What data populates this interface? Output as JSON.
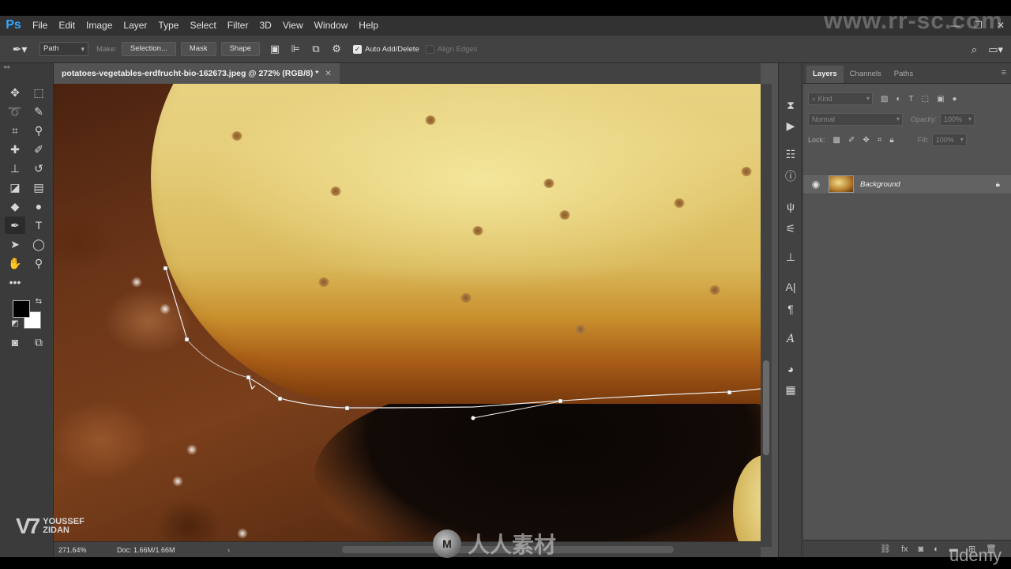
{
  "app": {
    "logo": "Ps"
  },
  "menu": [
    "File",
    "Edit",
    "Image",
    "Layer",
    "Type",
    "Select",
    "Filter",
    "3D",
    "View",
    "Window",
    "Help"
  ],
  "options": {
    "tool_mode": "Path",
    "make_label": "Make:",
    "selection_btn": "Selection...",
    "mask_btn": "Mask",
    "shape_btn": "Shape",
    "auto_add_delete": "Auto Add/Delete",
    "align_edges": "Align Edges"
  },
  "document": {
    "tab_title": "potatoes-vegetables-erdfrucht-bio-162673.jpeg @ 272% (RGB/8) *",
    "zoom": "271.64%",
    "doc_size": "Doc: 1.66M/1.66M"
  },
  "layers_panel": {
    "tabs": [
      "Layers",
      "Channels",
      "Paths"
    ],
    "active_tab": "Layers",
    "kind_label": "Kind",
    "blend_mode": "Normal",
    "opacity_label": "Opacity:",
    "opacity_value": "100%",
    "lock_label": "Lock:",
    "fill_label": "Fill:",
    "fill_value": "100%",
    "layers": [
      {
        "name": "Background",
        "visible": true,
        "locked": true
      }
    ]
  },
  "overlays": {
    "watermark_top": "www.rr-sc.com",
    "watermark_center": "人人素材",
    "brand_line1": "YOUSSEF",
    "brand_line2": "ZIDAN",
    "udemy": "udemy"
  },
  "colors": {
    "foreground": "#000000",
    "background": "#ffffff",
    "ps_blue": "#31a8ff"
  }
}
